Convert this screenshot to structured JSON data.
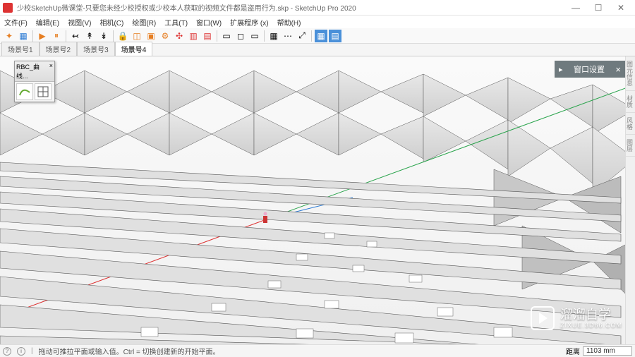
{
  "titlebar": {
    "title": "少校SketchUp微课堂-只要您未经少校授权或少校本人获取的视频文件都是盗用行为.skp - SketchUp Pro 2020",
    "min": "—",
    "max": "☐",
    "close": "✕"
  },
  "menu": {
    "file": "文件(F)",
    "edit": "编辑(E)",
    "view": "视图(V)",
    "camera": "相机(C)",
    "draw": "绘图(R)",
    "tools": "工具(T)",
    "window": "窗口(W)",
    "extensions": "扩展程序 (x)",
    "help": "帮助(H)"
  },
  "scenes": {
    "s1": "场景号1",
    "s2": "场景号2",
    "s3": "场景号3",
    "s4": "场景号4"
  },
  "float_tool": {
    "title": "RBC_曲线..."
  },
  "tray": {
    "title": "窗口设置",
    "arrow": "▸"
  },
  "right_tabs": {
    "t1": "图元信息",
    "t2": "材质",
    "t3": "风格",
    "t4": "图层"
  },
  "status": {
    "help1": "①",
    "help2": "①",
    "hint": "拖动可推拉平面或输入值。Ctrl = 切换创建新的开始平面。",
    "measure_label": "距离",
    "measure_value": "1103 mm"
  },
  "watermark": {
    "text": "溜溜自学",
    "sub": "ZIXUE.3D66.COM"
  }
}
